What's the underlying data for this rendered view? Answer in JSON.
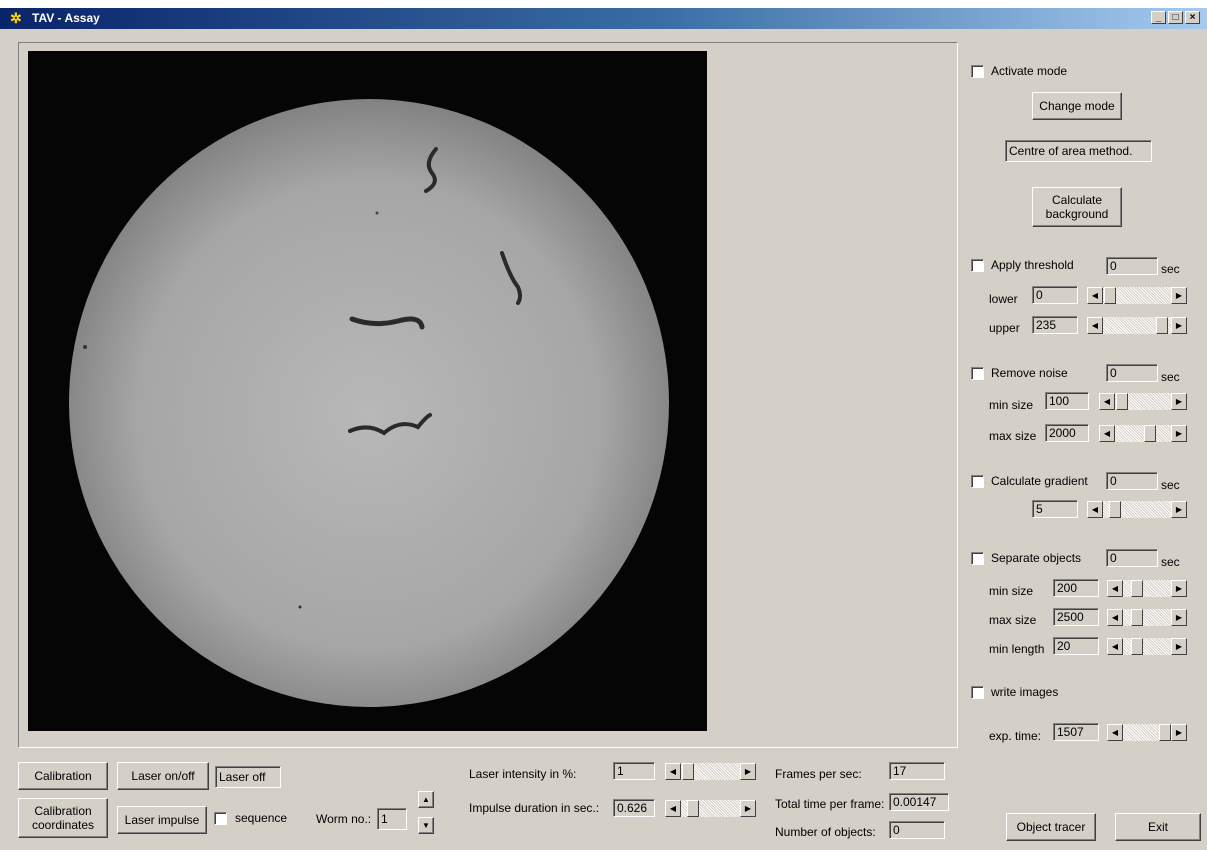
{
  "window": {
    "title": "TAV - Assay",
    "min": "_",
    "max": "□",
    "close": "×"
  },
  "right": {
    "activate_mode": "Activate mode",
    "change_mode": "Change mode",
    "method": "Centre of area method.",
    "calc_bg_line1": "Calculate",
    "calc_bg_line2": "background",
    "apply_threshold": "Apply threshold",
    "threshold_sec": "0",
    "sec": "sec",
    "lower_label": "lower",
    "lower": "0",
    "upper_label": "upper",
    "upper": "235",
    "remove_noise": "Remove noise",
    "noise_sec": "0",
    "min_size_label": "min size",
    "noise_min": "100",
    "max_size_label": "max size",
    "noise_max": "2000",
    "calc_gradient": "Calculate gradient",
    "gradient_sec": "0",
    "gradient_val": "5",
    "separate_objects": "Separate objects",
    "separate_sec": "0",
    "sep_min": "200",
    "sep_max": "2500",
    "min_length_label": "min length",
    "sep_len": "20",
    "write_images": "write images",
    "exp_time_label": "exp. time:",
    "exp_time": "1507",
    "object_tracer": "Object tracer",
    "exit": "Exit"
  },
  "bottom": {
    "calibration": "Calibration",
    "calib_coords_1": "Calibration",
    "calib_coords_2": "coordinates",
    "laser_onoff": "Laser on/off",
    "laser_status": "Laser off",
    "laser_impulse": "Laser impulse",
    "sequence": "sequence",
    "worm_no_label": "Worm no.:",
    "worm_no": "1",
    "laser_intensity_label": "Laser intensity in %:",
    "laser_intensity": "1",
    "impulse_label": "Impulse duration in sec.:",
    "impulse": "0.626",
    "fps_label": "Frames per sec:",
    "fps": "17",
    "total_time_label": "Total time per frame:",
    "total_time": "0.00147",
    "num_objects_label": "Number of objects:",
    "num_objects": "0"
  }
}
